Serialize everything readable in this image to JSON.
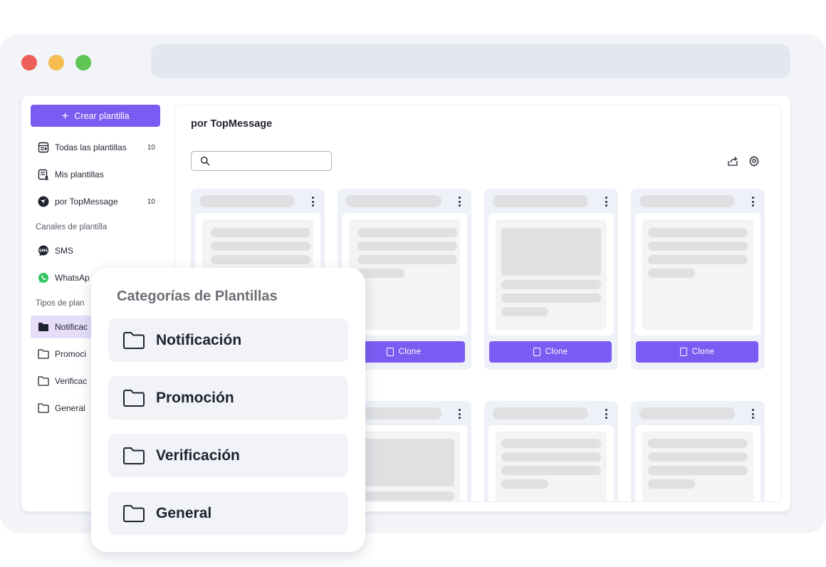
{
  "sidebar": {
    "create_label": "Crear plantilla",
    "items": [
      {
        "label": "Todas las plantillas",
        "count": "10",
        "icon": "templates-icon"
      },
      {
        "label": "Mis plantillas",
        "count": "",
        "icon": "my-templates-icon"
      },
      {
        "label": "por TopMessage",
        "count": "10",
        "icon": "topmessage-logo-icon"
      }
    ],
    "channels_heading": "Canales de plantilla",
    "channels": [
      {
        "label": "SMS",
        "icon": "sms-icon"
      },
      {
        "label": "WhatsAp",
        "icon": "whatsapp-icon"
      }
    ],
    "types_heading": "Tipos de plan",
    "types": [
      {
        "label": "Notificac",
        "icon": "folder-filled-icon",
        "active": true
      },
      {
        "label": "Promoci",
        "icon": "folder-icon"
      },
      {
        "label": "Verificac",
        "icon": "folder-icon"
      },
      {
        "label": "General",
        "icon": "folder-icon"
      }
    ]
  },
  "main": {
    "title": "por TopMessage",
    "search": {
      "value": "",
      "icon": "search-icon"
    },
    "tools": [
      "share-icon",
      "gear-icon"
    ],
    "clone_label": "Clone"
  },
  "popup": {
    "title": "Categorías de Plantillas",
    "categories": [
      "Notificación",
      "Promoción",
      "Verificación",
      "General"
    ]
  },
  "colors": {
    "accent": "#7b5cf2",
    "active_bg": "#e6def9",
    "window_bg": "#f2f4f8",
    "card_bg": "#eef1f8",
    "skeleton": "#e0e0e3"
  }
}
